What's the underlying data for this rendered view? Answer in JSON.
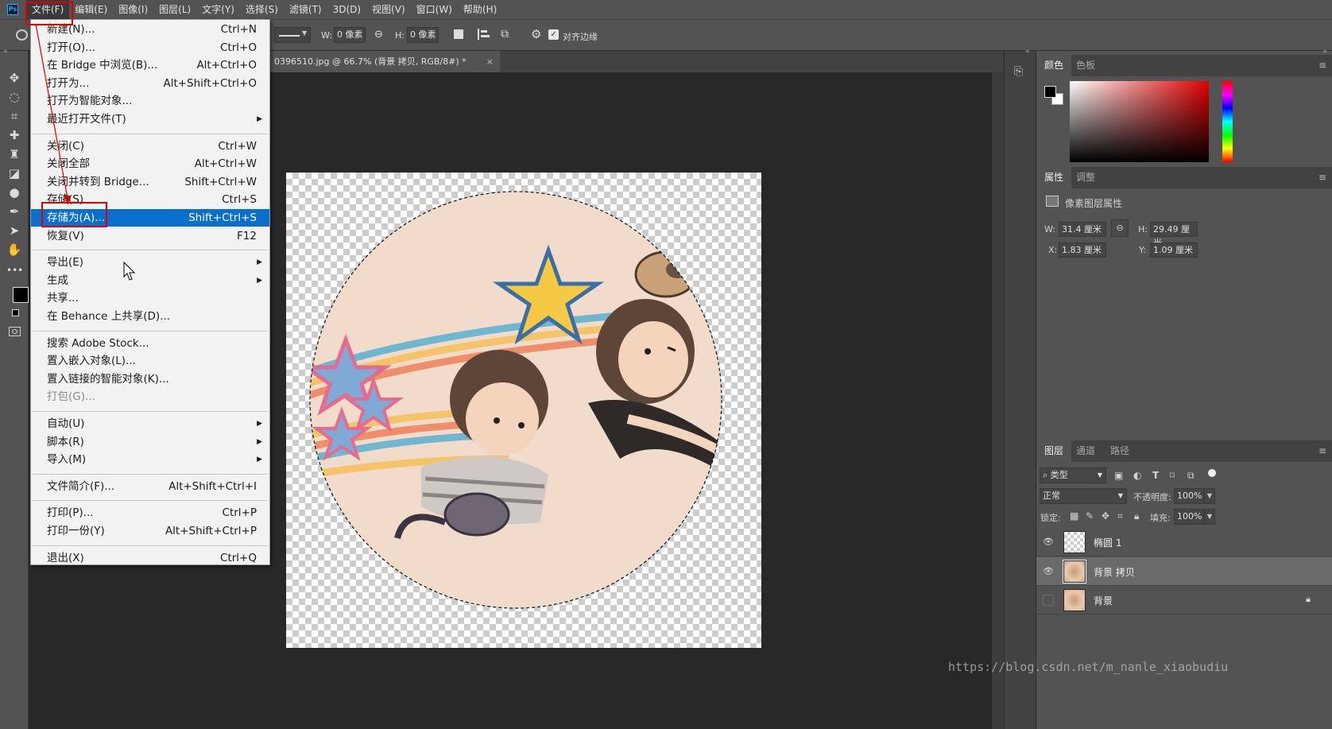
{
  "app": {
    "logo": "Ps"
  },
  "menubar": {
    "items": [
      "文件(F)",
      "编辑(E)",
      "图像(I)",
      "图层(L)",
      "文字(Y)",
      "选择(S)",
      "滤镜(T)",
      "3D(D)",
      "视图(V)",
      "窗口(W)",
      "帮助(H)"
    ]
  },
  "options": {
    "w_label": "W:",
    "w_value": "0 像素",
    "h_label": "H:",
    "h_value": "0 像素",
    "align_edges": "对齐边缘"
  },
  "document": {
    "tab_title": "0396510.jpg @ 66.7% (背景 拷贝, RGB/8#) *",
    "close": "×"
  },
  "file_menu": {
    "groups": [
      [
        {
          "label": "新建(N)...",
          "shortcut": "Ctrl+N"
        },
        {
          "label": "打开(O)...",
          "shortcut": "Ctrl+O"
        },
        {
          "label": "在 Bridge 中浏览(B)...",
          "shortcut": "Alt+Ctrl+O"
        },
        {
          "label": "打开为...",
          "shortcut": "Alt+Shift+Ctrl+O"
        },
        {
          "label": "打开为智能对象...",
          "shortcut": ""
        },
        {
          "label": "最近打开文件(T)",
          "shortcut": "",
          "submenu": true
        }
      ],
      [
        {
          "label": "关闭(C)",
          "shortcut": "Ctrl+W"
        },
        {
          "label": "关闭全部",
          "shortcut": "Alt+Ctrl+W"
        },
        {
          "label": "关闭并转到 Bridge...",
          "shortcut": "Shift+Ctrl+W"
        },
        {
          "label": "存储(S)",
          "shortcut": "Ctrl+S"
        },
        {
          "label": "存储为(A)...",
          "shortcut": "Shift+Ctrl+S",
          "highlighted": true
        },
        {
          "label": "恢复(V)",
          "shortcut": "F12"
        }
      ],
      [
        {
          "label": "导出(E)",
          "shortcut": "",
          "submenu": true
        },
        {
          "label": "生成",
          "shortcut": "",
          "submenu": true
        },
        {
          "label": "共享...",
          "shortcut": ""
        },
        {
          "label": "在 Behance 上共享(D)...",
          "shortcut": ""
        }
      ],
      [
        {
          "label": "搜索 Adobe Stock...",
          "shortcut": ""
        },
        {
          "label": "置入嵌入对象(L)...",
          "shortcut": ""
        },
        {
          "label": "置入链接的智能对象(K)...",
          "shortcut": ""
        },
        {
          "label": "打包(G)...",
          "shortcut": "",
          "disabled": true
        }
      ],
      [
        {
          "label": "自动(U)",
          "shortcut": "",
          "submenu": true
        },
        {
          "label": "脚本(R)",
          "shortcut": "",
          "submenu": true
        },
        {
          "label": "导入(M)",
          "shortcut": "",
          "submenu": true
        }
      ],
      [
        {
          "label": "文件简介(F)...",
          "shortcut": "Alt+Shift+Ctrl+I"
        }
      ],
      [
        {
          "label": "打印(P)...",
          "shortcut": "Ctrl+P"
        },
        {
          "label": "打印一份(Y)",
          "shortcut": "Alt+Shift+Ctrl+P"
        }
      ],
      [
        {
          "label": "退出(X)",
          "shortcut": "Ctrl+Q"
        }
      ]
    ]
  },
  "color_panel": {
    "tabs": [
      "颜色",
      "色板"
    ]
  },
  "properties_panel": {
    "tabs": [
      "属性",
      "调整"
    ],
    "title": "像素图层属性",
    "w_label": "W:",
    "w_value": "31.4 厘米",
    "h_label": "H:",
    "h_value": "29.49 厘米",
    "x_label": "X:",
    "x_value": "1.83 厘米",
    "y_label": "Y:",
    "y_value": "1.09 厘米"
  },
  "layers_panel": {
    "tabs": [
      "图层",
      "通道",
      "路径"
    ],
    "filter": "类型",
    "blend_mode": "正常",
    "opacity_label": "不透明度:",
    "opacity": "100%",
    "lock_label": "锁定:",
    "fill_label": "填充:",
    "fill": "100%",
    "layers": [
      {
        "name": "椭圆 1",
        "visible": true,
        "selected": false
      },
      {
        "name": "背景 拷贝",
        "visible": true,
        "selected": true
      },
      {
        "name": "背景",
        "visible": false,
        "selected": false,
        "locked": true
      }
    ]
  },
  "watermark": "https://blog.csdn.net/m_nanle_xiaobudiu",
  "colors": {
    "highlight": "#0a6fcc",
    "annotation": "#e00000"
  }
}
